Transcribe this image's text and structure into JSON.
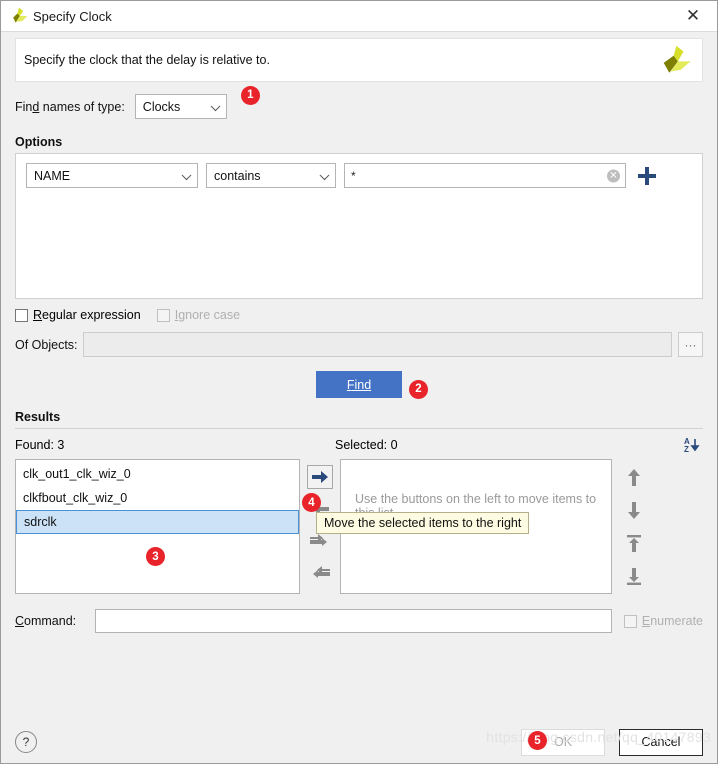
{
  "window": {
    "title": "Specify Clock",
    "close_label": "✕",
    "logo": "xilinx-logo"
  },
  "banner": {
    "text": "Specify the clock that the delay is relative to."
  },
  "find_type": {
    "label": "Find names of type:",
    "value": "Clocks"
  },
  "options": {
    "title": "Options",
    "field": "NAME",
    "operator": "contains",
    "pattern": "*",
    "clear_icon": "✕",
    "add_icon": "plus-icon"
  },
  "flags": {
    "regular_expression": "Regular expression",
    "ignore_case": "Ignore case"
  },
  "of_objects": {
    "label": "Of Objects:",
    "value": "",
    "browse_label": "···"
  },
  "find": {
    "label": "Find"
  },
  "results": {
    "title": "Results",
    "found_label": "Found: 3",
    "selected_label": "Selected: 0",
    "sort_icon": "sort-az-icon",
    "found_items": [
      "clk_out1_clk_wiz_0",
      "clkfbout_clk_wiz_0",
      "sdrclk"
    ],
    "selected_index": 2,
    "selected_items": [],
    "empty_hint": "Use the buttons on the left to move items to this list.",
    "tooltip": "Move the selected items to the right",
    "move_buttons": [
      "move-right-icon",
      "move-left-icon",
      "move-all-right-icon",
      "move-all-left-icon"
    ],
    "order_buttons": [
      "move-up-icon",
      "move-down-icon",
      "move-to-top-icon",
      "move-to-bottom-icon"
    ]
  },
  "command": {
    "label": "Command:",
    "value": "",
    "enumerate_label": "Enumerate"
  },
  "footer": {
    "help_label": "?",
    "ok_label": "OK",
    "cancel_label": "Cancel"
  },
  "badges": {
    "b1": "1",
    "b2": "2",
    "b3": "3",
    "b4": "4",
    "b5": "5"
  },
  "watermark": "https://blog.csdn.net/qq_40147893",
  "colors": {
    "accent_blue": "#4472c4",
    "badge_red": "#e8232a",
    "selection_blue": "#cbe2f7",
    "logo_green": "#c8d400",
    "tooltip_yellow": "#fdfbe2"
  }
}
